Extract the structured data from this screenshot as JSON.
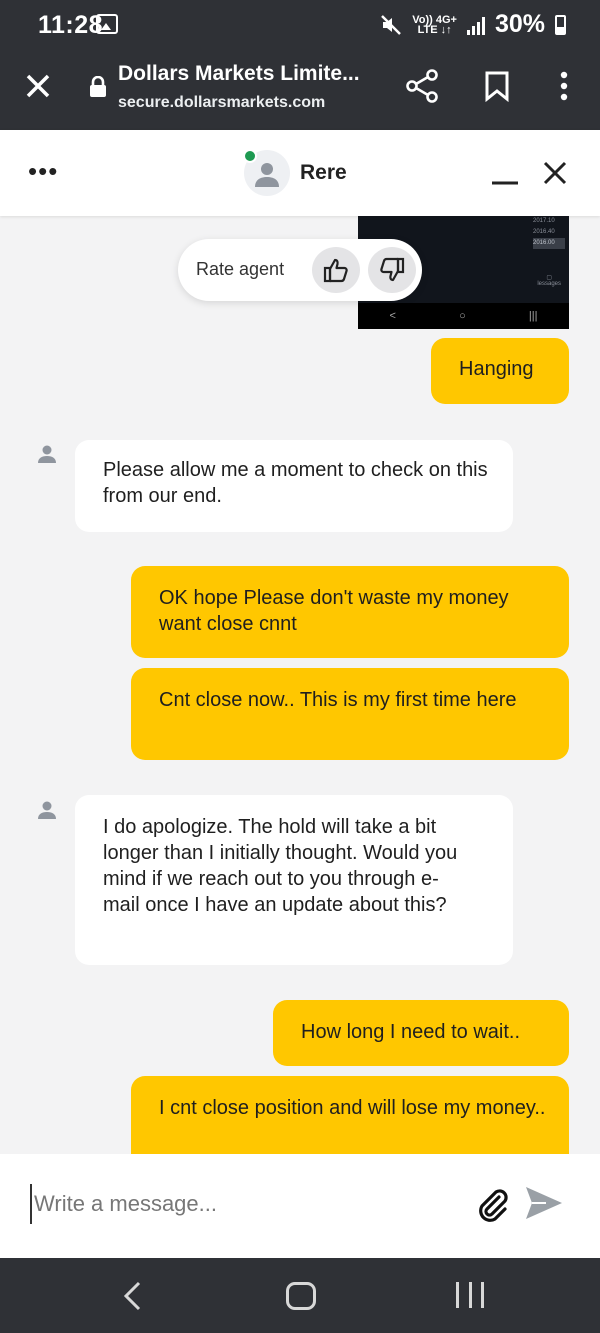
{
  "status": {
    "time": "11:28",
    "net_top": "Vo)) 4G+",
    "net_bottom": "LTE ↓↑",
    "battery": "30%"
  },
  "browser": {
    "title": "Dollars Markets Limite...",
    "url": "secure.dollarsmarkets.com"
  },
  "chat": {
    "agent_name": "Rere",
    "rate_label": "Rate agent",
    "image_preview": {
      "labels": [
        "2017.10",
        "2016.40",
        "2016.00"
      ],
      "messages_label": "lessages"
    },
    "messages": [
      {
        "sender": "user",
        "text": "Hanging"
      },
      {
        "sender": "agent",
        "text": "Please allow me a moment to check on this from our end."
      },
      {
        "sender": "user",
        "text": "OK hope Please don't waste my money want close cnnt"
      },
      {
        "sender": "user",
        "text": "Cnt close now.. This is my first time here"
      },
      {
        "sender": "agent",
        "text": "I do apologize. The hold will take a bit longer than I initially thought. Would you mind if we reach out to you through e-mail once I have an update about this?"
      },
      {
        "sender": "user",
        "text": "How long I need to wait.."
      },
      {
        "sender": "user",
        "text": "I cnt close position and will lose my money.."
      }
    ],
    "composer_placeholder": "Write a message..."
  },
  "colors": {
    "user_bubble": "#ffc700",
    "agent_bubble": "#ffffff",
    "online": "#1e9a52",
    "system_bar": "#2f3136"
  }
}
